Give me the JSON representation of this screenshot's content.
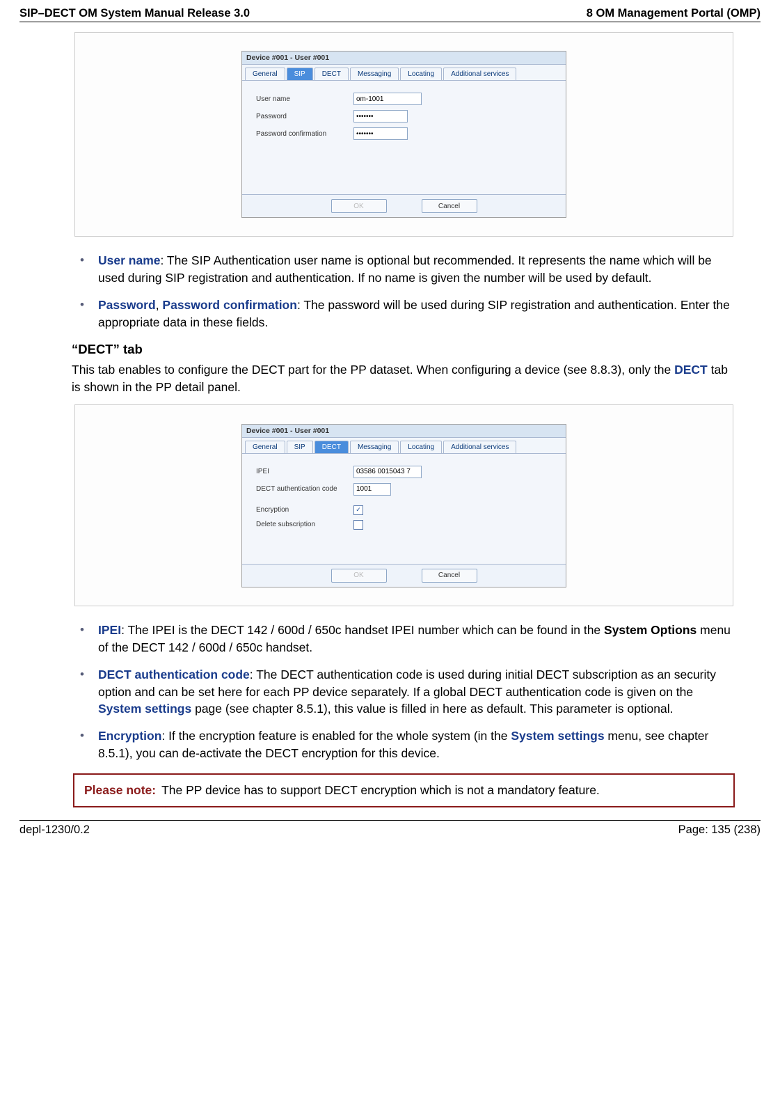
{
  "header": {
    "left": "SIP–DECT OM System Manual Release 3.0",
    "right": "8 OM Management Portal (OMP)"
  },
  "footer": {
    "left": "depl-1230/0.2",
    "right": "Page: 135 (238)"
  },
  "dialog1": {
    "title": "Device #001 - User #001",
    "tabs": [
      "General",
      "SIP",
      "DECT",
      "Messaging",
      "Locating",
      "Additional services"
    ],
    "rows": {
      "user_label": "User name",
      "user_value": "om-1001",
      "pw_label": "Password",
      "pw_value": "•••••••",
      "pwc_label": "Password confirmation",
      "pwc_value": "•••••••"
    },
    "ok": "OK",
    "cancel": "Cancel"
  },
  "dialog2": {
    "title": "Device #001 - User #001",
    "tabs": [
      "General",
      "SIP",
      "DECT",
      "Messaging",
      "Locating",
      "Additional services"
    ],
    "rows": {
      "ipei_label": "IPEI",
      "ipei_value": "03586 0015043 7",
      "dac_label": "DECT authentication code",
      "dac_value": "1001",
      "enc_label": "Encryption",
      "del_label": "Delete subscription"
    },
    "ok": "OK",
    "cancel": "Cancel"
  },
  "bullets1": {
    "b1_term": "User name",
    "b1_text": ": The SIP Authentication user name is optional but recommended. It represents the name which will be used during SIP registration and authentication. If no name is given the number will be used by default.",
    "b2_term1": "Password",
    "b2_sep": ", ",
    "b2_term2": "Password confirmation",
    "b2_text": ": The password will be used during SIP registration and authentication. Enter the appropriate data in these fields."
  },
  "section_dect_heading": "“DECT” tab",
  "section_dect_para_a": "This tab enables to configure the DECT part for the PP dataset. When configuring a device (see 8.8.3), only the ",
  "section_dect_link": "DECT",
  "section_dect_para_b": " tab is shown in the PP detail panel.",
  "bullets2": {
    "b1_term": "IPEI",
    "b1_text_a": ": The IPEI is the DECT 142 / 600d / 650c handset IPEI number which can be found in the ",
    "b1_bold": "System Options",
    "b1_text_b": " menu of the DECT 142 / 600d / 650c handset.",
    "b2_term": "DECT authentication code",
    "b2_text_a": ": The DECT authentication code is used during initial DECT subscription as an security option and can be set here for each PP device separately. If a global DECT authentication code is given on the ",
    "b2_link": "System settings",
    "b2_text_b": " page (see chapter 8.5.1), this value is filled in here as default. This parameter is optional.",
    "b3_term": "Encryption",
    "b3_text_a": ": If the encryption feature is enabled for the whole system (in the ",
    "b3_link": "System settings",
    "b3_text_b": " menu, see chapter 8.5.1), you can de-activate the DECT encryption for this device."
  },
  "note": {
    "label": "Please note:",
    "text": "The PP device has to support DECT encryption which is not a mandatory feature."
  }
}
